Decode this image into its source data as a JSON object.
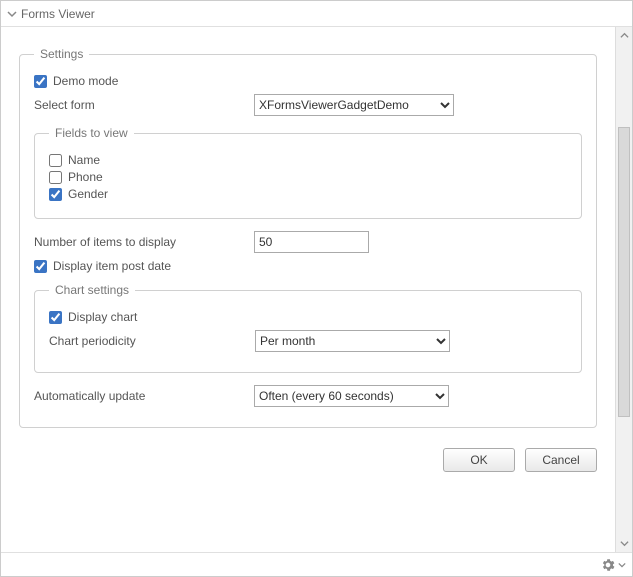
{
  "window": {
    "title": "Forms Viewer"
  },
  "settings": {
    "legend": "Settings",
    "demo_mode": {
      "label": "Demo mode",
      "checked": true
    },
    "select_form": {
      "label": "Select form",
      "value": "XFormsViewerGadgetDemo",
      "options": [
        "XFormsViewerGadgetDemo"
      ]
    },
    "fields_to_view": {
      "legend": "Fields to view",
      "items": [
        {
          "label": "Name",
          "checked": false
        },
        {
          "label": "Phone",
          "checked": false
        },
        {
          "label": "Gender",
          "checked": true
        }
      ]
    },
    "num_items": {
      "label": "Number of items to display",
      "value": "50"
    },
    "display_post_date": {
      "label": "Display item post date",
      "checked": true
    },
    "chart_settings": {
      "legend": "Chart settings",
      "display_chart": {
        "label": "Display chart",
        "checked": true
      },
      "periodicity": {
        "label": "Chart periodicity",
        "value": "Per month",
        "options": [
          "Per month"
        ]
      }
    },
    "auto_update": {
      "label": "Automatically update",
      "value": "Often (every 60 seconds)",
      "options": [
        "Often (every 60 seconds)"
      ]
    }
  },
  "buttons": {
    "ok": "OK",
    "cancel": "Cancel"
  }
}
